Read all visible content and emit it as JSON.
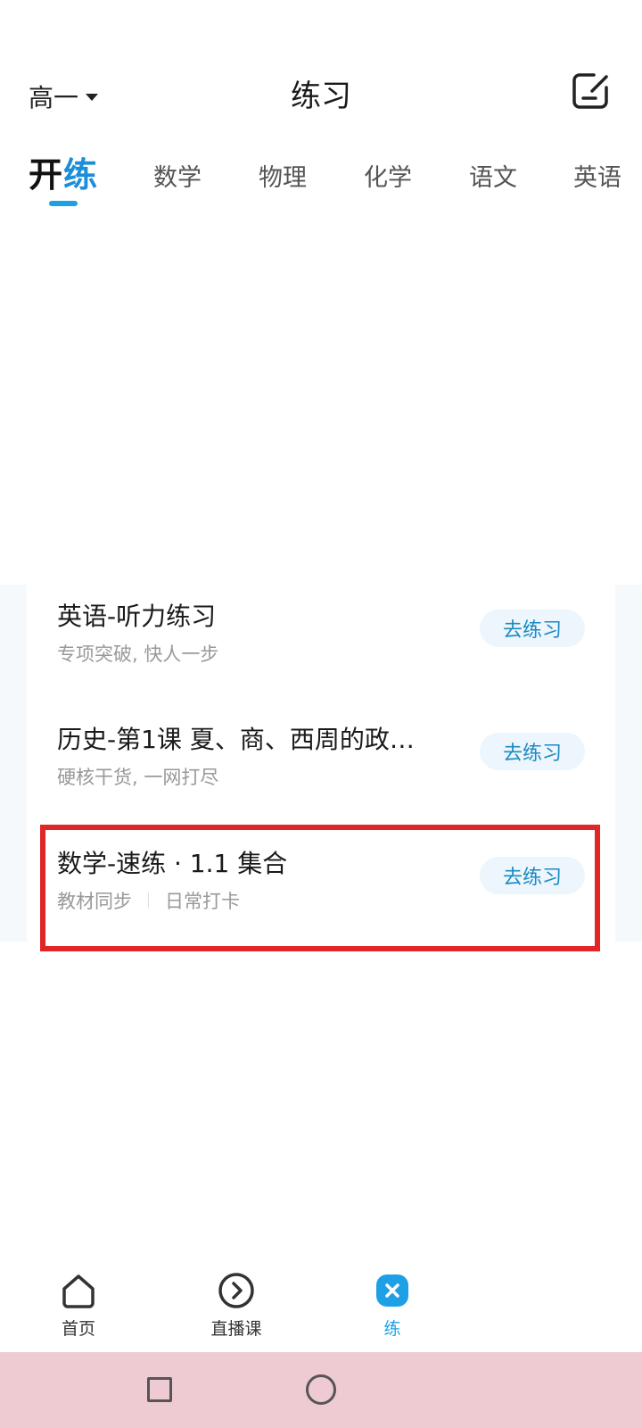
{
  "header": {
    "grade_label": "高一",
    "title": "练习"
  },
  "tabs": {
    "brand_left": "开",
    "brand_right": "练",
    "items": [
      "数学",
      "物理",
      "化学",
      "语文",
      "英语"
    ]
  },
  "practice_list": [
    {
      "title": "英语-听力练习",
      "subtitle": [
        "专项突破, 快人一步"
      ],
      "action": "去练习"
    },
    {
      "title": "历史-第1课 夏、商、西周的政…",
      "subtitle": [
        "硬核干货, 一网打尽"
      ],
      "action": "去练习"
    },
    {
      "title": "数学-速练 · 1.1 集合",
      "subtitle": [
        "教材同步",
        "日常打卡"
      ],
      "action": "去练习"
    }
  ],
  "bottom_nav": [
    {
      "label": "首页",
      "icon": "home-icon"
    },
    {
      "label": "直播课",
      "icon": "play-circle-icon"
    },
    {
      "label": "练",
      "icon": "practice-icon"
    }
  ],
  "colors": {
    "accent": "#1ea0e6",
    "action_text": "#1b8ac4",
    "action_bg": "#ecf6fc",
    "highlight": "#e02626"
  }
}
